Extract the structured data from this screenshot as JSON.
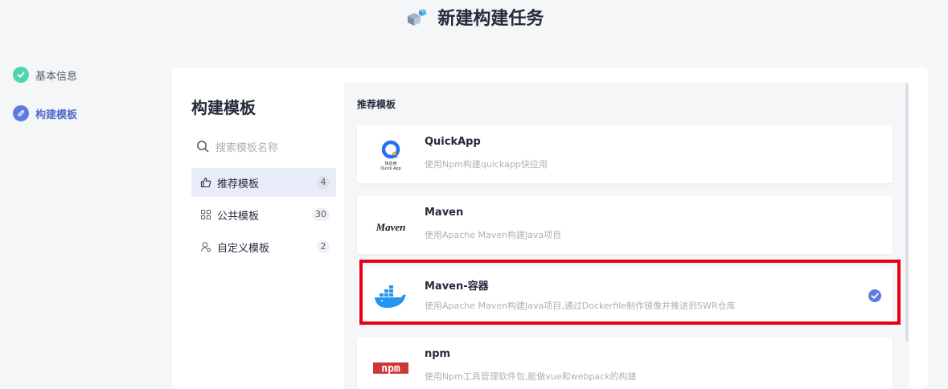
{
  "page": {
    "title": "新建构建任务"
  },
  "steps": [
    {
      "label": "基本信息",
      "status": "done"
    },
    {
      "label": "构建模板",
      "status": "active"
    }
  ],
  "left_panel": {
    "title": "构建模板",
    "search_placeholder": "搜索模板名称",
    "categories": [
      {
        "label": "推荐模板",
        "count": "4",
        "active": true
      },
      {
        "label": "公共模板",
        "count": "30",
        "active": false
      },
      {
        "label": "自定义模板",
        "count": "2",
        "active": false
      }
    ]
  },
  "right_panel": {
    "section_title": "推荐模板",
    "templates": [
      {
        "name": "QuickApp",
        "description": "使用Npm构建quickapp快应用",
        "logo_text": "快应用\nQuick App",
        "selected": false
      },
      {
        "name": "Maven",
        "description": "使用Apache Maven构建Java项目",
        "logo_text": "Maven",
        "selected": false
      },
      {
        "name": "Maven-容器",
        "description": "使用Apache Maven构建Java项目,通过Dockerfile制作镜像并推送到SWR仓库",
        "selected": true
      },
      {
        "name": "npm",
        "description": "使用Npm工具管理软件包,能做vue和webpack的构建",
        "logo_text": "npm",
        "selected": false
      }
    ]
  },
  "colors": {
    "accent": "#5e7ce0",
    "done": "#50d4ab",
    "highlight": "#e60012"
  }
}
